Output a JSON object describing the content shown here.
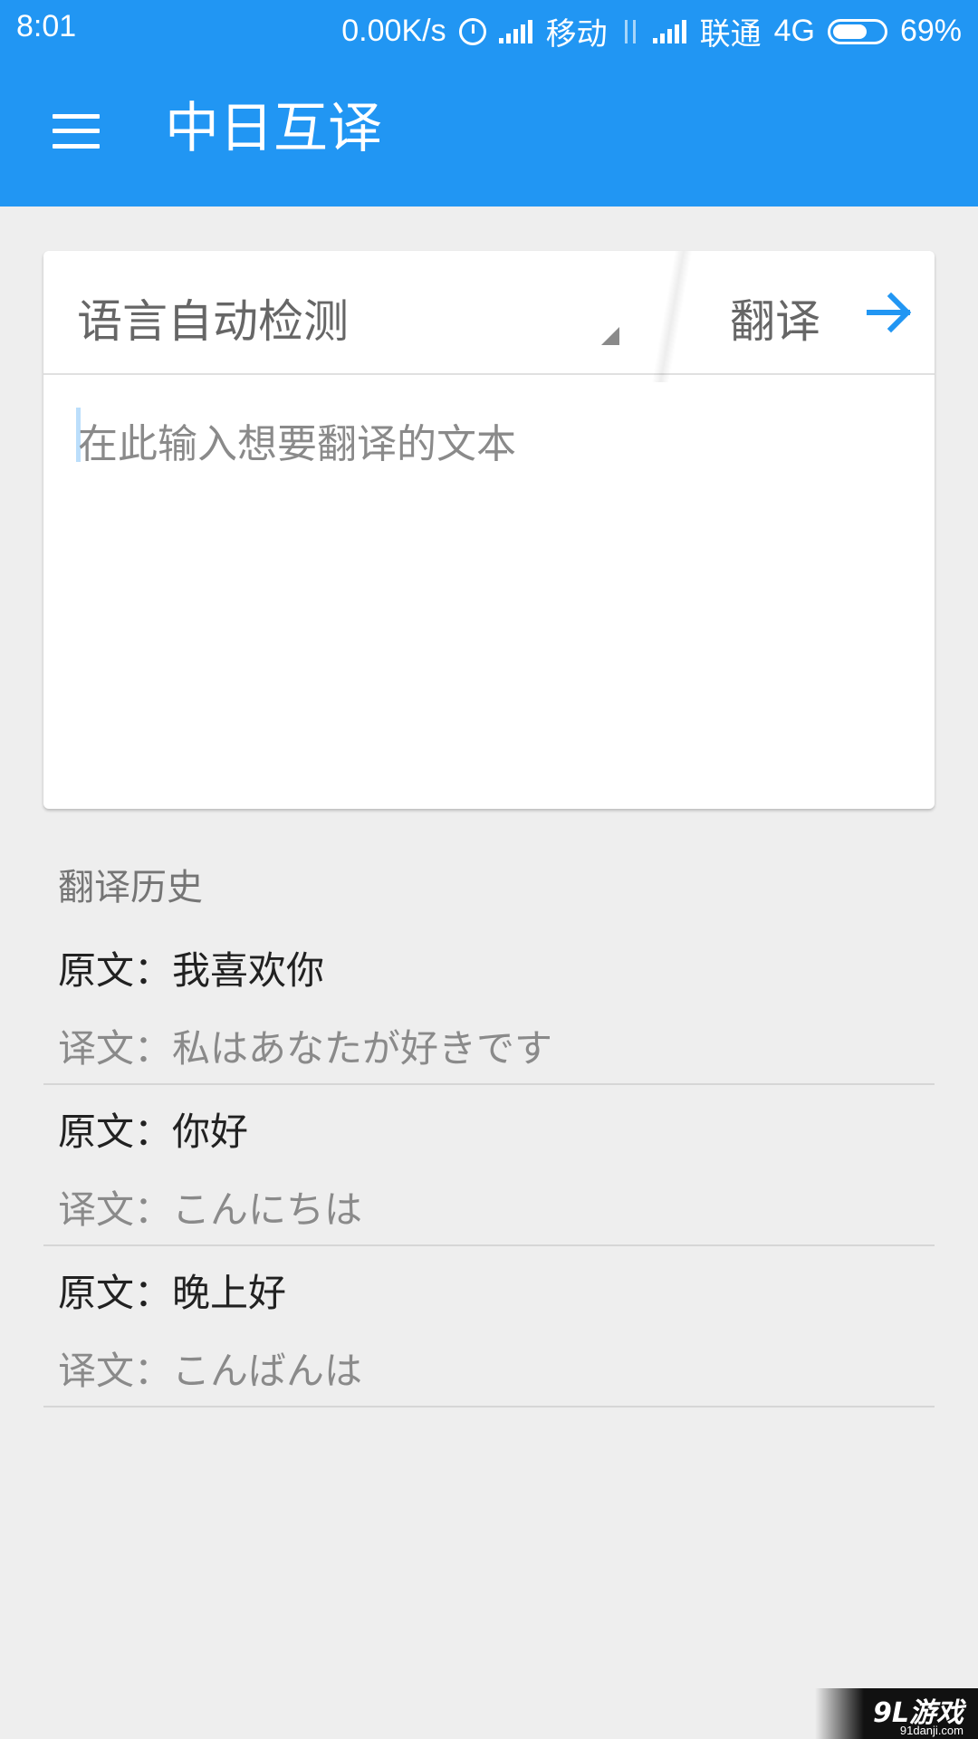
{
  "status_bar": {
    "time": "8:01",
    "net_speed": "0.00K/s",
    "carrier1": "移动",
    "carrier2": "联通",
    "network_type": "4G",
    "battery": "69%",
    "battery_level": 0.69
  },
  "app_bar": {
    "menu_icon": "menu-icon",
    "title": "中日互译"
  },
  "translator": {
    "language_select": "语言自动检测",
    "translate_label": "翻译",
    "arrow_icon": "arrow-right-icon",
    "input_value": "",
    "input_placeholder": "在此输入想要翻译的文本"
  },
  "history": {
    "title": "翻译历史",
    "items": [
      {
        "original": "原文：我喜欢你",
        "translation": "译文：私はあなたが好きです"
      },
      {
        "original": "原文：你好",
        "translation": "译文：こんにちは"
      },
      {
        "original": "原文：晚上好",
        "translation": "译文：こんばんは"
      }
    ]
  },
  "watermark": {
    "logo_text": "9L游戏",
    "site": "91danji.com"
  },
  "colors": {
    "primary": "#2196f3",
    "background": "#eeeeee"
  }
}
